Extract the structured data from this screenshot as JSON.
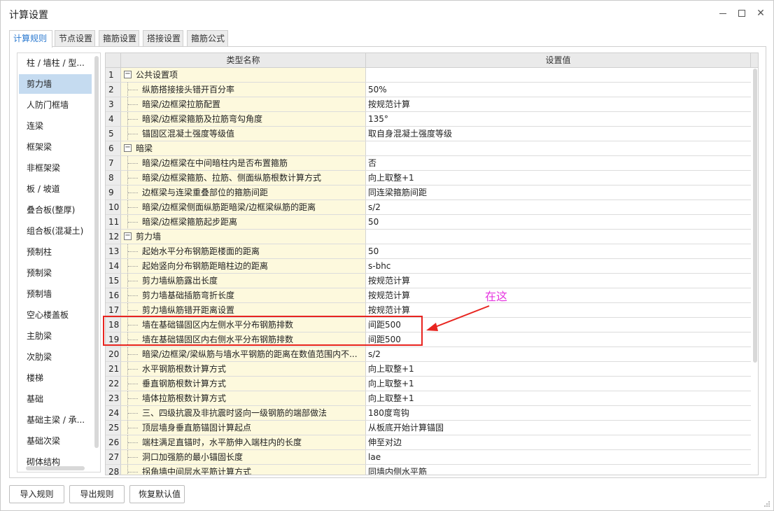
{
  "window": {
    "title": "计算设置"
  },
  "tabs": [
    {
      "label": "计算规则",
      "active": true
    },
    {
      "label": "节点设置"
    },
    {
      "label": "箍筋设置"
    },
    {
      "label": "搭接设置"
    },
    {
      "label": "箍筋公式"
    }
  ],
  "sidebar": {
    "selected": "剪力墙",
    "items": [
      "柱 / 墙柱 / 型...",
      "剪力墙",
      "人防门框墙",
      "连梁",
      "框架梁",
      "非框架梁",
      "板 / 坡道",
      "叠合板(整厚)",
      "组合板(混凝土)",
      "预制柱",
      "预制梁",
      "预制墙",
      "空心楼盖板",
      "主肋梁",
      "次肋梁",
      "楼梯",
      "基础",
      "基础主梁 / 承...",
      "基础次梁",
      "砌体结构"
    ]
  },
  "grid": {
    "headers": {
      "num": "",
      "name": "类型名称",
      "value": "设置值"
    },
    "rows": [
      {
        "num": "1",
        "name": "公共设置项",
        "value": "",
        "group": true
      },
      {
        "num": "2",
        "name": "纵筋搭接接头错开百分率",
        "value": "50%"
      },
      {
        "num": "3",
        "name": "暗梁/边框梁拉筋配置",
        "value": "按规范计算"
      },
      {
        "num": "4",
        "name": "暗梁/边框梁箍筋及拉筋弯勾角度",
        "value": "135°"
      },
      {
        "num": "5",
        "name": "锚固区混凝土强度等级值",
        "value": "取自身混凝土强度等级"
      },
      {
        "num": "6",
        "name": "暗梁",
        "value": "",
        "group": true
      },
      {
        "num": "7",
        "name": "暗梁/边框梁在中间暗柱内是否布置箍筋",
        "value": "否"
      },
      {
        "num": "8",
        "name": "暗梁/边框梁箍筋、拉筋、侧面纵筋根数计算方式",
        "value": "向上取整+1"
      },
      {
        "num": "9",
        "name": "边框梁与连梁重叠部位的箍筋间距",
        "value": "同连梁箍筋间距"
      },
      {
        "num": "10",
        "name": "暗梁/边框梁侧面纵筋距暗梁/边框梁纵筋的距离",
        "value": "s/2"
      },
      {
        "num": "11",
        "name": "暗梁/边框梁箍筋起步距离",
        "value": "50"
      },
      {
        "num": "12",
        "name": "剪力墙",
        "value": "",
        "group": true
      },
      {
        "num": "13",
        "name": "起始水平分布钢筋距楼面的距离",
        "value": "50"
      },
      {
        "num": "14",
        "name": "起始竖向分布钢筋距暗柱边的距离",
        "value": "s-bhc"
      },
      {
        "num": "15",
        "name": "剪力墙纵筋露出长度",
        "value": "按规范计算"
      },
      {
        "num": "16",
        "name": "剪力墙基础插筋弯折长度",
        "value": "按规范计算"
      },
      {
        "num": "17",
        "name": "剪力墙纵筋错开距离设置",
        "value": "按规范计算"
      },
      {
        "num": "18",
        "name": "墙在基础锚固区内左侧水平分布钢筋排数",
        "value": "间距500"
      },
      {
        "num": "19",
        "name": "墙在基础锚固区内右侧水平分布钢筋排数",
        "value": "间距500"
      },
      {
        "num": "20",
        "name": "暗梁/边框梁/梁纵筋与墙水平钢筋的距离在数值范围内不...",
        "value": "s/2"
      },
      {
        "num": "21",
        "name": "水平钢筋根数计算方式",
        "value": "向上取整+1"
      },
      {
        "num": "22",
        "name": "垂直钢筋根数计算方式",
        "value": "向上取整+1"
      },
      {
        "num": "23",
        "name": "墙体拉筋根数计算方式",
        "value": "向上取整+1"
      },
      {
        "num": "24",
        "name": "三、四级抗震及非抗震时竖向一级钢筋的端部做法",
        "value": "180度弯钩"
      },
      {
        "num": "25",
        "name": "顶层墙身垂直筋锚固计算起点",
        "value": "从板底开始计算锚固"
      },
      {
        "num": "26",
        "name": "端柱满足直锚时，水平筋伸入端柱内的长度",
        "value": "伸至对边"
      },
      {
        "num": "27",
        "name": "洞口加强筋的最小锚固长度",
        "value": "lae"
      },
      {
        "num": "28",
        "name": "拐角墙中间层水平筋计算方式",
        "value": "同墙内侧水平筋"
      }
    ]
  },
  "annotation": {
    "text": "在这",
    "color": "#e637e0",
    "box_color": "#e8241f"
  },
  "buttons": {
    "import": "导入规则",
    "export": "导出规则",
    "restore": "恢复默认值"
  },
  "icons": {
    "minimize": "minimize-icon",
    "maximize": "maximize-icon",
    "close": "close-icon",
    "collapse": "minus-box-icon",
    "resize": "resize-grip-icon"
  }
}
